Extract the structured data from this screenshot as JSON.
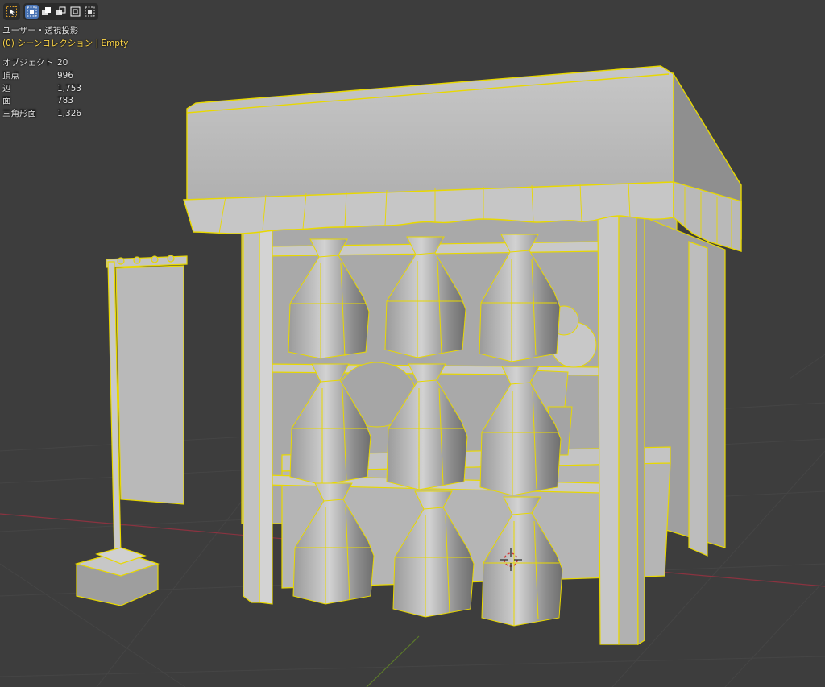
{
  "viewport": {
    "view_title": "ユーザー・透視投影",
    "collection_prefix": "(0)",
    "collection_name": "シーンコレクション",
    "separator": "|",
    "active_object": "Empty"
  },
  "toolbar": {
    "tools": [
      {
        "icon": "select-cursor-icon",
        "active": false
      },
      {
        "icon": "select-box-new-icon",
        "active": true
      },
      {
        "icon": "select-box-extend-icon",
        "active": false
      },
      {
        "icon": "select-box-subtract-icon",
        "active": false
      },
      {
        "icon": "select-box-intersect-icon",
        "active": false
      },
      {
        "icon": "select-box-invert-icon",
        "active": false
      }
    ]
  },
  "stats": [
    {
      "label": "オブジェクト",
      "value": "20"
    },
    {
      "label": "頂点",
      "value": "996"
    },
    {
      "label": "辺",
      "value": "1,753"
    },
    {
      "label": "面",
      "value": "783"
    },
    {
      "label": "三角形面",
      "value": "1,326"
    }
  ],
  "colors": {
    "background": "#3d3d3d",
    "grid_line": "#454545",
    "x_axis": "#8a3340",
    "y_axis": "#5c7a2a",
    "selection_outline": "#e8d800",
    "mesh_fill": "#b3b3b3",
    "active_tool": "#4772b3",
    "collection_text": "#ffd84a"
  }
}
